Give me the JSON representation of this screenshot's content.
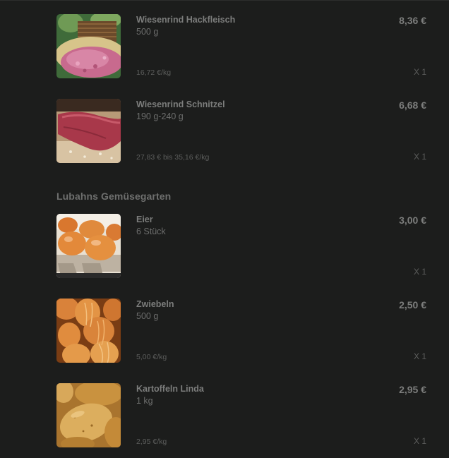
{
  "items_top": [
    {
      "name": "Wiesenrind Hackfleisch",
      "amount": "500 g",
      "unit_price": "16,72 €/kg",
      "price": "8,36 €",
      "count": "X 1",
      "image": "minced-beef-photo"
    },
    {
      "name": "Wiesenrind Schnitzel",
      "amount": "190 g-240 g",
      "unit_price": "27,83 € bis 35,16 €/kg",
      "price": "6,68 €",
      "count": "X 1",
      "image": "beef-schnitzel-photo"
    }
  ],
  "section": {
    "title": "Lubahns Gemüsegarten"
  },
  "items_bottom": [
    {
      "name": "Eier",
      "amount": "6 Stück",
      "unit_price": "",
      "price": "3,00 €",
      "count": "X 1",
      "image": "eggs-photo"
    },
    {
      "name": "Zwiebeln",
      "amount": "500 g",
      "unit_price": "5,00 €/kg",
      "price": "2,50 €",
      "count": "X 1",
      "image": "onions-photo"
    },
    {
      "name": "Kartoffeln Linda",
      "amount": "1 kg",
      "unit_price": "2,95 €/kg",
      "price": "2,95 €",
      "count": "X 1",
      "image": "potatoes-photo"
    }
  ]
}
